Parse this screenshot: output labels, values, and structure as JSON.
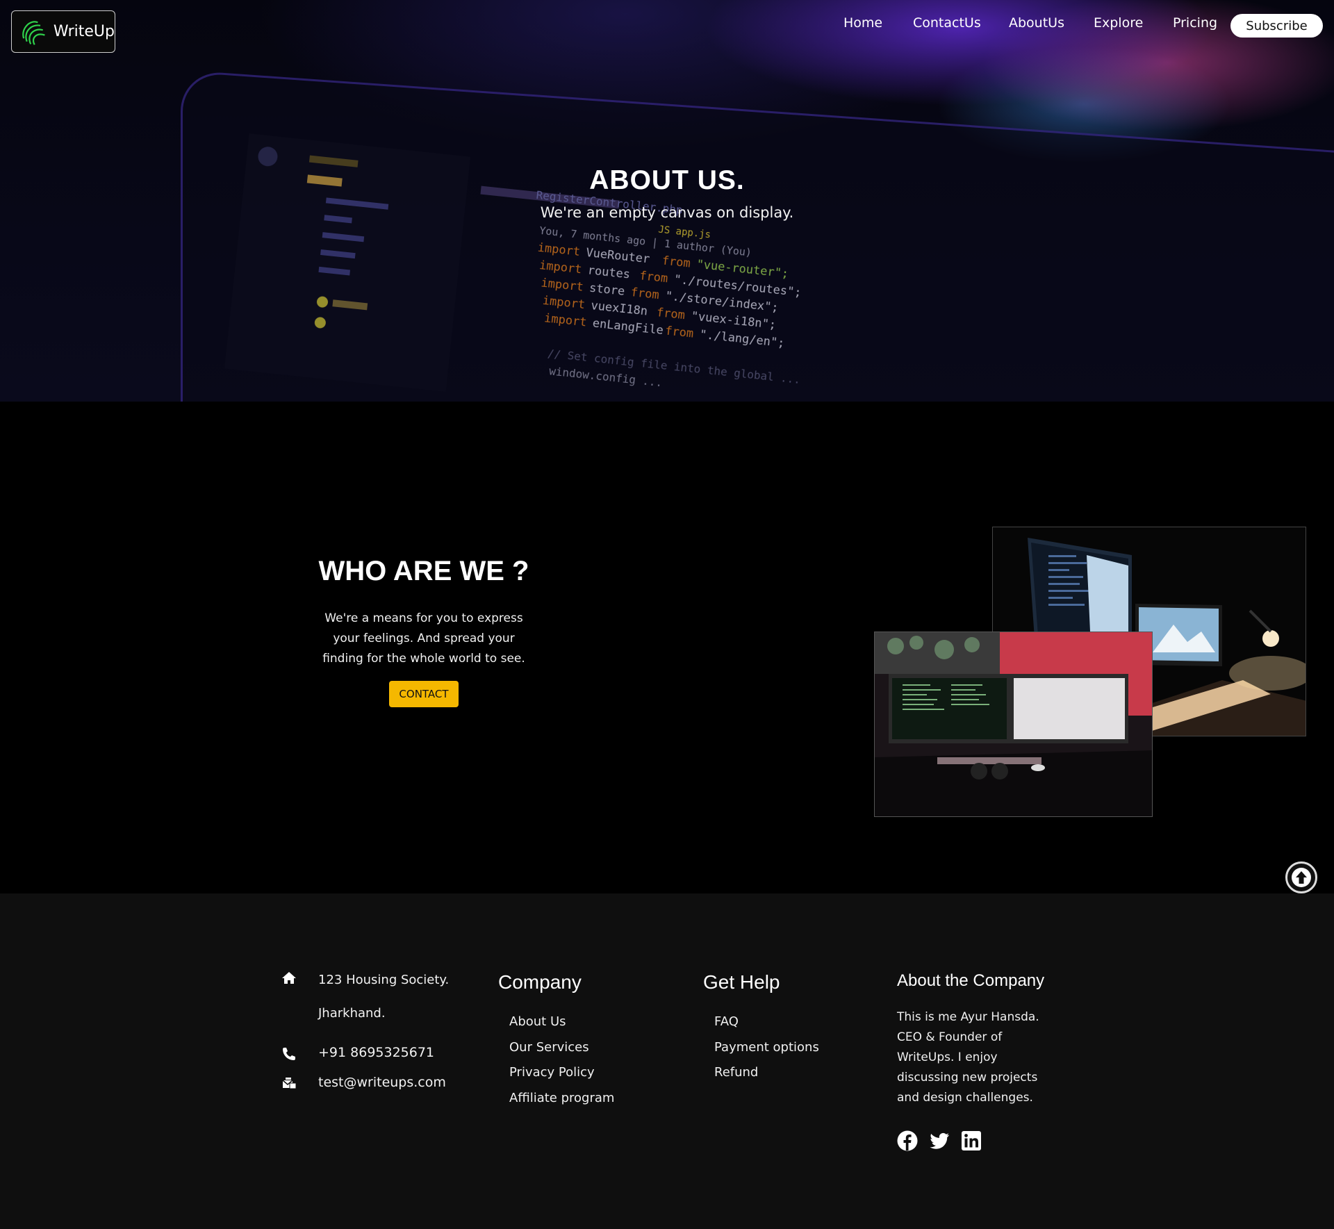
{
  "nav": {
    "logo_text": "WriteUp",
    "links": [
      "Home",
      "ContactUs",
      "AboutUs",
      "Explore",
      "Pricing"
    ],
    "subscribe_label": "Subscribe"
  },
  "hero": {
    "title": "ABOUT US.",
    "subtitle": "We're an empty canvas on display."
  },
  "about": {
    "title": "WHO ARE WE ?",
    "lines": [
      "We're a means for you to express",
      "your feelings. And spread your",
      "finding for the whole world to see."
    ],
    "contact_label": "CONTACT"
  },
  "footer": {
    "address_line1": "123 Housing Society.",
    "address_line2": "Jharkhand.",
    "phone": "+91 8695325671",
    "email": "test@writeups.com",
    "company": {
      "heading": "Company",
      "links": [
        "About Us",
        "Our Services",
        "Privacy Policy",
        "Affiliate program"
      ]
    },
    "help": {
      "heading": "Get Help",
      "links": [
        "FAQ",
        "Payment options",
        "Refund"
      ]
    },
    "about_company": {
      "heading": "About the Company",
      "lines": [
        "This is me Ayur Hansda.",
        "CEO & Founder of",
        "WriteUps. I enjoy",
        "discussing new projects",
        "and design challenges."
      ]
    }
  },
  "colors": {
    "accent": "#f5b800",
    "logo_green": "#2fd14b",
    "footer_bg": "#0f0f0f"
  }
}
